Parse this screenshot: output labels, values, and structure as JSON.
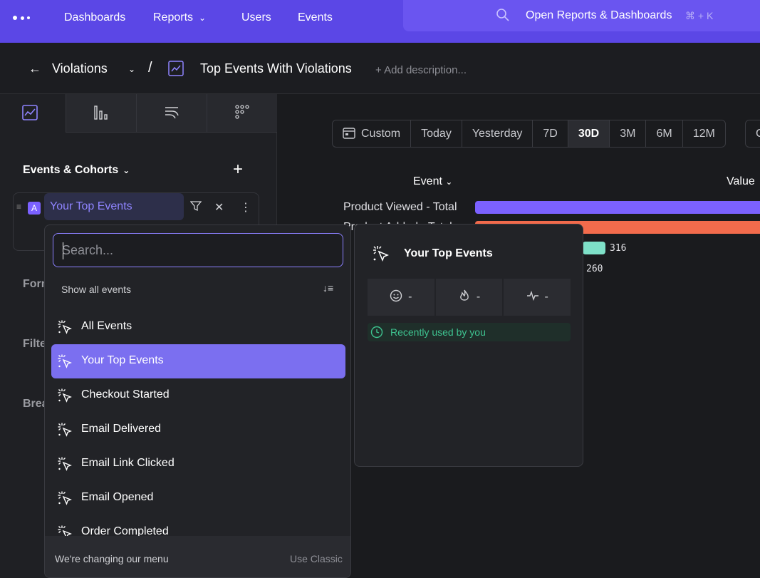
{
  "nav": {
    "items": [
      "Dashboards",
      "Reports",
      "Users",
      "Events"
    ],
    "search_label": "Open Reports & Dashboards",
    "shortcut": "⌘ + K"
  },
  "header": {
    "back_crumb": "Violations",
    "separator": "/",
    "title": "Top Events With Violations",
    "add_description": "+ Add description..."
  },
  "left_panel": {
    "section_title": "Events & Cohorts",
    "event_letter": "A",
    "event_name": "Your Top Events",
    "side_labels": [
      "Formula",
      "Filter",
      "Breakdown"
    ]
  },
  "date_range": {
    "options": [
      "Custom",
      "Today",
      "Yesterday",
      "7D",
      "30D",
      "3M",
      "6M",
      "12M"
    ],
    "selected": "30D",
    "extra": "C"
  },
  "table": {
    "event_header": "Event",
    "value_header": "Value",
    "rows": [
      {
        "label": "Product Viewed - Total",
        "value": "",
        "color": "#7b61ff",
        "fraction": 1.0
      },
      {
        "label": "Product Added - Total",
        "value": "",
        "color": "#f26b4c",
        "fraction": 1.0
      },
      {
        "label": "",
        "value": "316",
        "color": "#7ee0c8",
        "fraction": 0.31
      },
      {
        "label": "",
        "value": "260",
        "color": "#5a6bff",
        "fraction": 0.26
      }
    ]
  },
  "dropdown": {
    "search_placeholder": "Search...",
    "show_all": "Show all events",
    "items": [
      "All Events",
      "Your Top Events",
      "Checkout Started",
      "Email Delivered",
      "Email Link Clicked",
      "Email Opened",
      "Order Completed"
    ],
    "selected": "Your Top Events",
    "footer_text": "We're changing our menu",
    "footer_link": "Use Classic"
  },
  "info_panel": {
    "title": "Your Top Events",
    "stats": [
      "-",
      "-",
      "-"
    ],
    "recently_used": "Recently used by you"
  },
  "colors": {
    "brand": "#5b47e6",
    "accent": "#7b6ff0",
    "success": "#3ec28f"
  }
}
